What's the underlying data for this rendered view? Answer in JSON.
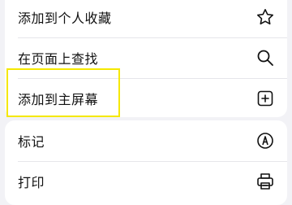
{
  "menu": {
    "group1": [
      {
        "label": "添加到个人收藏",
        "icon": "star-icon"
      },
      {
        "label": "在页面上查找",
        "icon": "search-icon"
      },
      {
        "label": "添加到主屏幕",
        "icon": "plus-square-icon"
      }
    ],
    "group2": [
      {
        "label": "标记",
        "icon": "markup-pen-icon"
      },
      {
        "label": "打印",
        "icon": "printer-icon"
      }
    ]
  },
  "highlight_color": "#f5e800"
}
